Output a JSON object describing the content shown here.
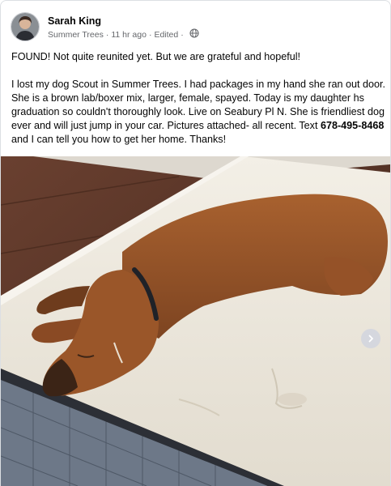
{
  "post": {
    "author": "Sarah King",
    "group": "Summer Trees",
    "time": "11 hr ago",
    "edited": "Edited",
    "separator": "·",
    "paragraph1": "FOUND!  Not quite reunited yet.  But we are grateful and hopeful!",
    "paragraph2_before_phone": "I lost my dog Scout in Summer Trees.  I had packages in my hand she ran out door.  She is a brown lab/boxer mix, larger, female, spayed.  Today is my daughter hs graduation so couldn't thoroughly look.  Live on Seabury Pl N. She is friendliest dog ever and will just jump in your car.  Pictures attached- all recent.  Text ",
    "phone": "678-495-8468",
    "paragraph2_after_phone": " and I can tell you how to get her home. Thanks!"
  },
  "icons": {
    "privacy": "globe-icon",
    "next": "chevron-right-icon"
  },
  "colors": {
    "text": "#050505",
    "secondary_text": "#65676b",
    "dog": "#93532a",
    "mattress": "#ece7dc",
    "floor": "#5a3526"
  }
}
